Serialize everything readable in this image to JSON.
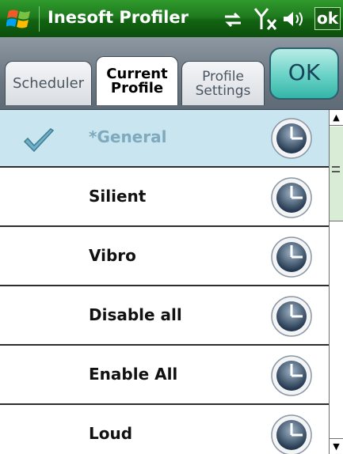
{
  "titlebar": {
    "title": "Inesoft Profiler",
    "ok_label": "ok",
    "icons": [
      "windows-start-icon",
      "sync-icon",
      "signal-no-service-icon",
      "volume-icon"
    ]
  },
  "tabs": [
    {
      "label": "Scheduler",
      "active": false
    },
    {
      "label": "Current\nProfile",
      "active": true
    },
    {
      "label": "Profile\nSettings",
      "active": false
    }
  ],
  "ok_button": {
    "label": "OK"
  },
  "profiles": [
    {
      "name": "*General",
      "selected": true
    },
    {
      "name": "Silient",
      "selected": false
    },
    {
      "name": "Vibro",
      "selected": false
    },
    {
      "name": "Disable all",
      "selected": false
    },
    {
      "name": "Enable All",
      "selected": false
    },
    {
      "name": "Loud",
      "selected": false
    }
  ],
  "colors": {
    "titlebar": "#1f7a1e",
    "selected_row": "#c9e5ef",
    "ok_button": "#6fd4c9"
  }
}
